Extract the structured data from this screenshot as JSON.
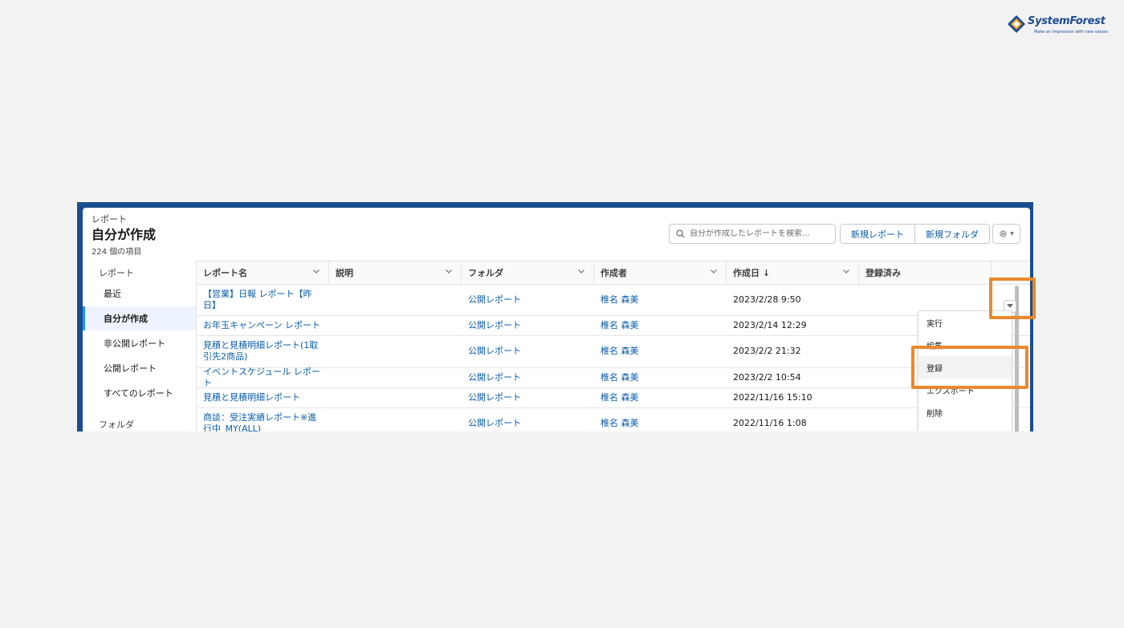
{
  "brand": {
    "name": "SystemForest",
    "tagline": "Make an impression with new values",
    "color": "#1e4c94"
  },
  "header": {
    "eyebrow": "レポート",
    "title": "自分が作成",
    "count": "224 個の項目",
    "search_placeholder": "自分が作成したレポートを検索...",
    "new_report_label": "新規レポート",
    "new_folder_label": "新規フォルダ"
  },
  "sidebar": {
    "reports_heading": "レポート",
    "items": [
      {
        "label": "最近"
      },
      {
        "label": "自分が作成"
      },
      {
        "label": "非公開レポート"
      },
      {
        "label": "公開レポート"
      },
      {
        "label": "すべてのレポート"
      }
    ],
    "folders_heading": "フォルダ"
  },
  "table": {
    "columns": [
      "レポート名",
      "説明",
      "フォルダ",
      "作成者",
      "作成日 ↓",
      "登録済み"
    ],
    "rows": [
      {
        "name": "【営業】日報 レポート【昨日】",
        "folder": "公開レポート",
        "owner": "椎名 森美",
        "created": "2023/2/28 9:50"
      },
      {
        "name": "お年玉キャンペーン レポート",
        "folder": "公開レポート",
        "owner": "椎名 森美",
        "created": "2023/2/14 12:29"
      },
      {
        "name": "見積と見積明細レポート(1取引先2商品)",
        "folder": "公開レポート",
        "owner": "椎名 森美",
        "created": "2023/2/2 21:32"
      },
      {
        "name": "イベントスケジュール レポート",
        "folder": "公開レポート",
        "owner": "椎名 森美",
        "created": "2023/2/2 10:54"
      },
      {
        "name": "見積と見積明細レポート",
        "folder": "公開レポート",
        "owner": "椎名 森美",
        "created": "2022/11/16 15:10"
      },
      {
        "name": "商談：受注実績レポート※進行中_MY(ALL)",
        "folder": "公開レポート",
        "owner": "椎名 森美",
        "created": "2022/11/16 1:08"
      }
    ]
  },
  "row_menu": {
    "items": [
      "実行",
      "編集",
      "登録",
      "エクスポート",
      "削除"
    ]
  },
  "accent": {
    "highlight": "#e8892c",
    "link": "#0b5cab",
    "header_band": "#1a4d8f"
  }
}
